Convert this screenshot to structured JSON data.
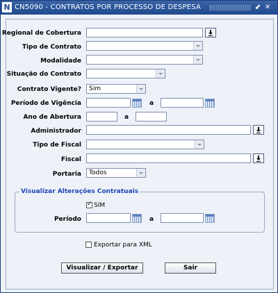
{
  "window": {
    "app_icon": "N",
    "title": "CN5090 - CONTRATOS POR PROCESSO DE DESPESA",
    "controls": [
      "⬋",
      "✕"
    ]
  },
  "form": {
    "regional": {
      "label": "Regional de Cobertura",
      "value": ""
    },
    "tipo_contrato": {
      "label": "Tipo de Contrato",
      "value": ""
    },
    "modalidade": {
      "label": "Modalidade",
      "value": ""
    },
    "situacao": {
      "label": "Situação do Contrato",
      "value": ""
    },
    "vigente": {
      "label": "Contrato Vigente?",
      "value": "Sim"
    },
    "periodo_vigencia": {
      "label": "Período de Vigência",
      "from": "",
      "sep": "a",
      "to": ""
    },
    "ano_abertura": {
      "label": "Ano de Abertura",
      "from": "",
      "sep": "a",
      "to": ""
    },
    "administrador": {
      "label": "Administrador",
      "value": ""
    },
    "tipo_fiscal": {
      "label": "Tipo de Fiscal",
      "value": ""
    },
    "fiscal": {
      "label": "Fiscal",
      "value": ""
    },
    "portaria": {
      "label": "Portaria",
      "value": "Todos"
    }
  },
  "alteracoes": {
    "title": "Visualizar Alterações Contratuais",
    "sim_label": "SIM",
    "sim_checked": true,
    "periodo": {
      "label": "Período",
      "from": "",
      "sep": "a",
      "to": ""
    }
  },
  "export_xml": {
    "label": "Exportar para XML",
    "checked": false
  },
  "buttons": {
    "visualizar": "Visualizar / Exportar",
    "sair": "Sair"
  },
  "icons": {
    "lov": "download-arrow-icon",
    "calendar": "calendar-icon",
    "dropdown": "chevron-down-icon"
  }
}
